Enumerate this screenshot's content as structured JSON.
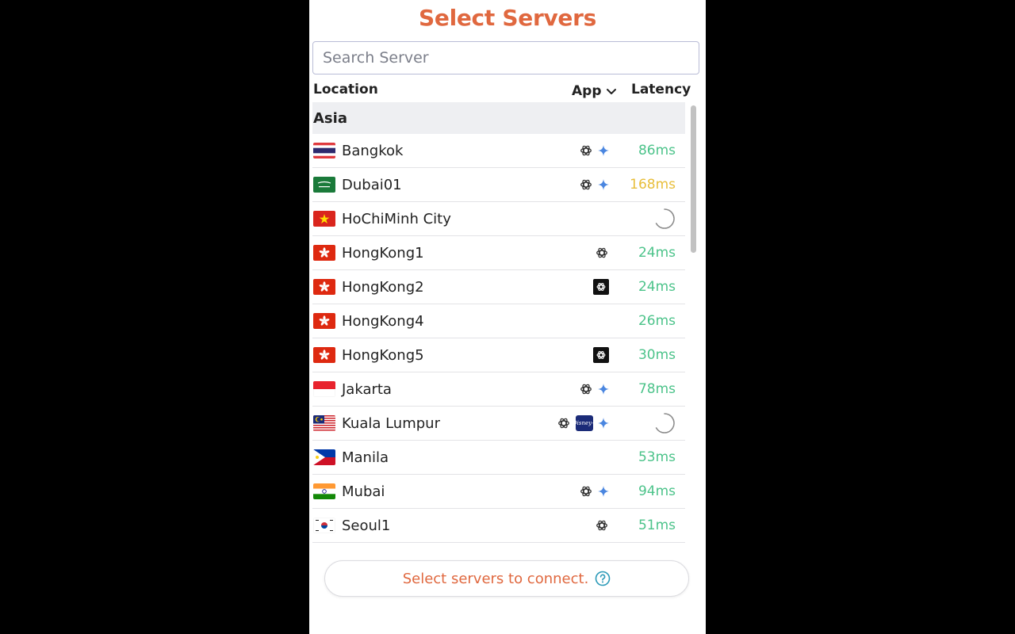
{
  "title": "Select Servers",
  "search": {
    "placeholder": "Search Server",
    "value": ""
  },
  "columns": {
    "location": "Location",
    "app": "App",
    "latency": "Latency"
  },
  "group": "Asia",
  "servers": [
    {
      "city": "Bangkok",
      "latency": "86ms"
    },
    {
      "city": "Dubai01",
      "latency": "168ms"
    },
    {
      "city": "HoChiMinh City",
      "latency": ""
    },
    {
      "city": "HongKong1",
      "latency": "24ms"
    },
    {
      "city": "HongKong2",
      "latency": "24ms"
    },
    {
      "city": "HongKong4",
      "latency": "26ms"
    },
    {
      "city": "HongKong5",
      "latency": "30ms"
    },
    {
      "city": "Jakarta",
      "latency": "78ms"
    },
    {
      "city": "Kuala Lumpur",
      "latency": ""
    },
    {
      "city": "Manila",
      "latency": "53ms"
    },
    {
      "city": "Mubai",
      "latency": "94ms"
    },
    {
      "city": "Seoul1",
      "latency": "51ms"
    }
  ],
  "disney_badge": "Disney+",
  "footer": {
    "text": "Select servers to connect."
  },
  "colors": {
    "accent": "#e0683f",
    "latency_good": "#4cc38a",
    "latency_warn": "#e8be3a",
    "help": "#2c9ab8"
  }
}
